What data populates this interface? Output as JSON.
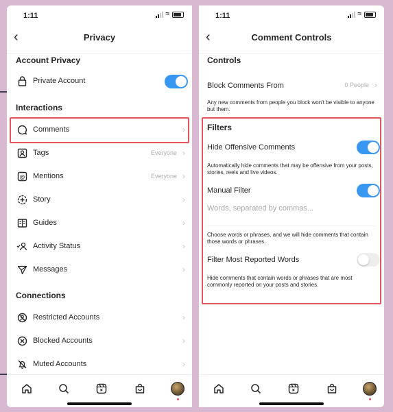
{
  "left": {
    "status_time": "1:11",
    "title": "Privacy",
    "section_account": "Account Privacy",
    "private_account_label": "Private Account",
    "private_account_on": true,
    "section_interactions": "Interactions",
    "items": [
      {
        "label": "Comments",
        "value": "",
        "icon": "comment-icon"
      },
      {
        "label": "Tags",
        "value": "Everyone",
        "icon": "tag-person-icon"
      },
      {
        "label": "Mentions",
        "value": "Everyone",
        "icon": "at-sign-icon"
      },
      {
        "label": "Story",
        "value": "",
        "icon": "story-plus-icon"
      },
      {
        "label": "Guides",
        "value": "",
        "icon": "guides-icon"
      },
      {
        "label": "Activity Status",
        "value": "",
        "icon": "activity-status-icon"
      },
      {
        "label": "Messages",
        "value": "",
        "icon": "paper-plane-icon"
      }
    ],
    "section_connections": "Connections",
    "connections": [
      {
        "label": "Restricted Accounts",
        "icon": "restricted-icon"
      },
      {
        "label": "Blocked Accounts",
        "icon": "blocked-icon"
      },
      {
        "label": "Muted Accounts",
        "icon": "muted-bell-icon"
      }
    ]
  },
  "right": {
    "status_time": "1:11",
    "title": "Comment Controls",
    "section_controls": "Controls",
    "block_label": "Block Comments From",
    "block_value": "0 People",
    "block_hint": "Any new comments from people you block won't be visible to anyone but them.",
    "section_filters": "Filters",
    "hide_offensive_label": "Hide Offensive Comments",
    "hide_offensive_on": true,
    "hide_offensive_hint": "Automatically hide comments that may be offensive from your posts, stories, reels and live videos.",
    "manual_filter_label": "Manual Filter",
    "manual_filter_on": true,
    "manual_filter_placeholder": "Words, separated by commas...",
    "manual_filter_hint": "Choose words or phrases, and we will hide comments that contain those words or phrases.",
    "most_reported_label": "Filter Most Reported Words",
    "most_reported_on": false,
    "most_reported_hint": "Hide comments that contain words or phrases that are most commonly reported on your posts and stories."
  },
  "colors": {
    "accent": "#3897f0",
    "highlight": "#e2575b",
    "notification": "#ed4956",
    "background": "#d9b8d2"
  },
  "tabbar_icons": [
    "home-icon",
    "search-icon",
    "reels-icon",
    "shop-icon",
    "profile-avatar"
  ]
}
